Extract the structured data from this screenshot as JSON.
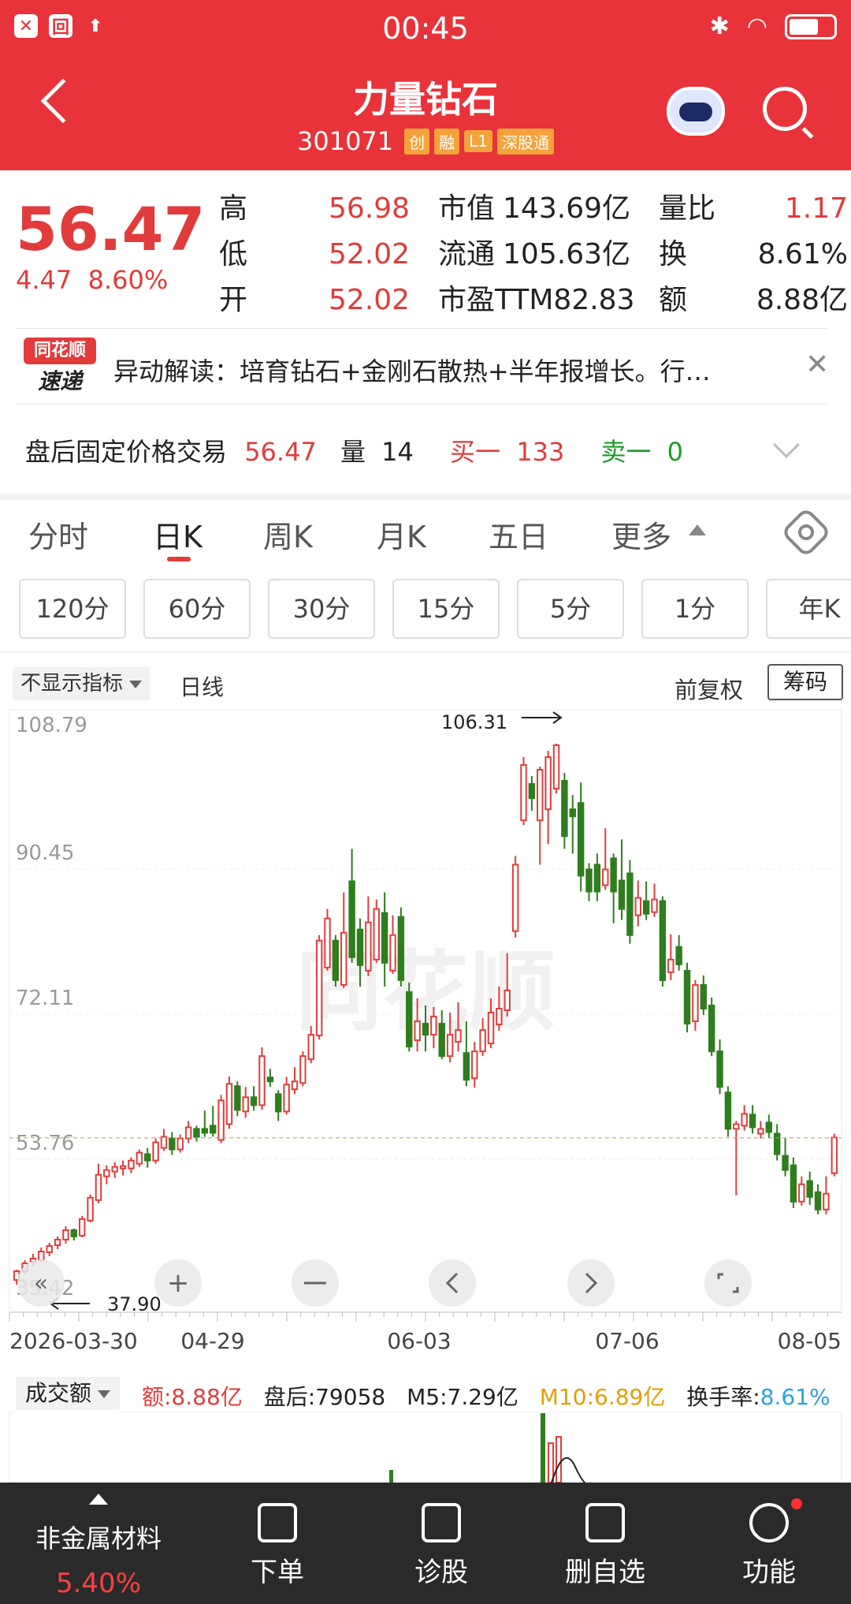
{
  "status_bar": {
    "time": "00:45"
  },
  "header": {
    "title": "力量钻石",
    "code": "301071",
    "tags": [
      "创",
      "融",
      "L1",
      "深股通"
    ]
  },
  "quote": {
    "price": "56.47",
    "change": "4.47",
    "change_pct": "8.60%",
    "col1": [
      {
        "label": "高",
        "value": "56.98"
      },
      {
        "label": "低",
        "value": "52.02"
      },
      {
        "label": "开",
        "value": "52.02"
      }
    ],
    "col2": [
      {
        "label": "市值",
        "value": "143.69亿"
      },
      {
        "label": "流通",
        "value": "105.63亿"
      },
      {
        "label": "市盈TTM",
        "value": "82.83"
      }
    ],
    "col3": [
      {
        "label": "量比",
        "value": "1.17"
      },
      {
        "label": "换",
        "value": "8.61%"
      },
      {
        "label": "额",
        "value": "8.88亿"
      }
    ]
  },
  "news": {
    "logo_top": "同花顺",
    "logo_bottom": "速递",
    "text": "异动解读：培育钻石+金刚石散热+半年报增长。行…"
  },
  "after_hours": {
    "label": "盘后固定价格交易",
    "price": "56.47",
    "vol_label": "量",
    "vol": "14",
    "buy_label": "买一",
    "buy": "133",
    "sell_label": "卖一",
    "sell": "0"
  },
  "tabs": [
    "分时",
    "日K",
    "周K",
    "月K",
    "五日",
    "更多"
  ],
  "periods": [
    "120分",
    "60分",
    "30分",
    "15分",
    "5分",
    "1分",
    "年K"
  ],
  "chart_toolbar": {
    "indicator": "不显示指标",
    "line_type": "日线",
    "adjust": "前复权",
    "chips": "筹码"
  },
  "chart_data": {
    "type": "candlestick",
    "y_ticks": [
      "108.79",
      "90.45",
      "72.11",
      "53.76",
      "35.42"
    ],
    "ylim": [
      35.42,
      108.79
    ],
    "x_ticks": [
      "2026-03-30",
      "04-29",
      "06-03",
      "07-06",
      "08-05"
    ],
    "max_label": "106.31",
    "min_label": "37.90",
    "last_close": 56.47,
    "up_color": "#e23b3b",
    "down_color": "#2f7d1f",
    "candles": [
      [
        38.5,
        39.6,
        37.9,
        39.8
      ],
      [
        39.6,
        40.6,
        39.3,
        41.0
      ],
      [
        40.8,
        41.2,
        40.2,
        41.8
      ],
      [
        41.0,
        42.1,
        40.8,
        42.6
      ],
      [
        42.0,
        42.8,
        41.5,
        43.2
      ],
      [
        42.9,
        43.6,
        42.4,
        44.0
      ],
      [
        43.6,
        44.8,
        43.1,
        45.3
      ],
      [
        44.8,
        44.0,
        43.5,
        45.0
      ],
      [
        44.1,
        46.2,
        43.9,
        46.6
      ],
      [
        46.0,
        48.9,
        45.8,
        49.3
      ],
      [
        48.6,
        51.8,
        48.2,
        53.2
      ],
      [
        51.6,
        52.4,
        50.6,
        53.0
      ],
      [
        52.2,
        52.8,
        51.4,
        53.4
      ],
      [
        52.6,
        52.9,
        51.7,
        53.6
      ],
      [
        52.6,
        53.6,
        52.0,
        54.0
      ],
      [
        53.2,
        54.6,
        52.8,
        55.0
      ],
      [
        54.4,
        53.6,
        52.7,
        55.2
      ],
      [
        53.6,
        55.9,
        53.2,
        56.4
      ],
      [
        55.2,
        56.6,
        54.8,
        57.6
      ],
      [
        56.4,
        55.0,
        54.3,
        57.2
      ],
      [
        55.0,
        56.4,
        54.6,
        56.9
      ],
      [
        56.4,
        57.8,
        55.8,
        58.6
      ],
      [
        57.6,
        56.6,
        56.0,
        58.0
      ],
      [
        57.6,
        57.1,
        56.6,
        59.9
      ],
      [
        58.0,
        57.1,
        56.6,
        60.5
      ],
      [
        56.2,
        61.2,
        55.8,
        61.9
      ],
      [
        58.2,
        63.3,
        57.6,
        64.2
      ],
      [
        63.0,
        60.0,
        59.2,
        63.6
      ],
      [
        59.8,
        61.6,
        59.0,
        62.9
      ],
      [
        61.6,
        60.6,
        59.9,
        63.0
      ],
      [
        60.6,
        66.8,
        60.0,
        67.9
      ],
      [
        64.1,
        63.6,
        62.9,
        65.2
      ],
      [
        62.0,
        59.8,
        58.6,
        62.5
      ],
      [
        59.8,
        63.2,
        59.4,
        64.2
      ],
      [
        62.6,
        63.6,
        62.0,
        65.4
      ],
      [
        63.4,
        66.8,
        63.0,
        67.4
      ],
      [
        66.4,
        69.5,
        65.9,
        70.6
      ],
      [
        69.4,
        81.4,
        68.9,
        82.1
      ],
      [
        78.0,
        84.2,
        77.6,
        85.4
      ],
      [
        81.4,
        76.4,
        75.6,
        82.1
      ],
      [
        75.8,
        82.4,
        75.4,
        87.5
      ],
      [
        88.9,
        79.3,
        78.6,
        93.0
      ],
      [
        82.8,
        78.3,
        75.6,
        84.2
      ],
      [
        77.6,
        83.7,
        76.9,
        87.0
      ],
      [
        79.0,
        85.4,
        78.6,
        86.6
      ],
      [
        84.9,
        78.6,
        75.6,
        87.5
      ],
      [
        77.6,
        82.1,
        77.2,
        84.6
      ],
      [
        84.4,
        76.4,
        75.6,
        85.6
      ],
      [
        74.9,
        68.0,
        67.4,
        76.1
      ],
      [
        68.8,
        71.2,
        67.4,
        74.1
      ],
      [
        70.9,
        69.5,
        67.4,
        73.2
      ],
      [
        69.5,
        71.8,
        67.8,
        73.0
      ],
      [
        70.9,
        66.8,
        66.4,
        72.6
      ],
      [
        66.8,
        69.5,
        66.0,
        72.3
      ],
      [
        68.6,
        70.1,
        67.4,
        73.6
      ],
      [
        67.2,
        63.8,
        63.0,
        71.2
      ],
      [
        64.0,
        67.4,
        62.8,
        68.6
      ],
      [
        67.4,
        70.1,
        66.8,
        71.6
      ],
      [
        68.4,
        72.3,
        67.8,
        74.1
      ],
      [
        70.8,
        72.8,
        70.0,
        75.6
      ],
      [
        72.6,
        75.1,
        71.8,
        79.8
      ],
      [
        82.6,
        91.0,
        81.8,
        92.1
      ],
      [
        96.6,
        103.6,
        96.0,
        104.6
      ],
      [
        101.2,
        99.4,
        97.8,
        102.2
      ],
      [
        96.6,
        103.0,
        91.0,
        103.4
      ],
      [
        98.0,
        104.6,
        93.6,
        105.4
      ],
      [
        100.6,
        106.1,
        100.0,
        106.3
      ],
      [
        101.6,
        94.6,
        93.0,
        102.6
      ],
      [
        98.0,
        97.1,
        92.4,
        99.8
      ],
      [
        98.8,
        89.6,
        87.6,
        101.4
      ],
      [
        90.4,
        87.6,
        86.4,
        91.2
      ],
      [
        91.0,
        87.6,
        86.4,
        92.4
      ],
      [
        88.4,
        90.4,
        87.8,
        95.6
      ],
      [
        91.8,
        87.6,
        83.6,
        92.4
      ],
      [
        89.0,
        85.4,
        84.0,
        94.2
      ],
      [
        89.9,
        82.1,
        81.0,
        91.6
      ],
      [
        84.6,
        86.8,
        83.2,
        89.0
      ],
      [
        86.4,
        84.8,
        84.0,
        88.9
      ],
      [
        85.0,
        86.6,
        84.4,
        88.6
      ],
      [
        86.4,
        76.4,
        75.6,
        87.0
      ],
      [
        77.4,
        79.0,
        76.4,
        82.2
      ],
      [
        80.6,
        78.4,
        77.6,
        82.1
      ],
      [
        77.6,
        70.9,
        69.8,
        78.6
      ],
      [
        71.2,
        75.8,
        70.0,
        76.4
      ],
      [
        75.8,
        72.8,
        72.0,
        77.0
      ],
      [
        73.2,
        67.4,
        66.8,
        74.2
      ],
      [
        67.4,
        62.9,
        62.0,
        68.9
      ],
      [
        62.2,
        57.6,
        56.6,
        63.0
      ],
      [
        57.6,
        58.2,
        49.2,
        58.6
      ],
      [
        58.0,
        59.5,
        57.4,
        60.6
      ],
      [
        59.4,
        57.8,
        57.0,
        60.6
      ],
      [
        57.0,
        57.6,
        56.4,
        58.6
      ],
      [
        58.4,
        57.2,
        56.4,
        59.4
      ],
      [
        57.0,
        54.4,
        53.6,
        58.2
      ],
      [
        54.2,
        52.4,
        51.6,
        56.4
      ],
      [
        53.0,
        48.4,
        47.6,
        54.0
      ],
      [
        48.4,
        50.6,
        47.9,
        51.6
      ],
      [
        51.0,
        49.0,
        48.0,
        52.2
      ],
      [
        49.6,
        47.4,
        46.8,
        50.6
      ],
      [
        47.4,
        49.4,
        46.8,
        51.6
      ],
      [
        52.0,
        56.5,
        51.6,
        57.0
      ]
    ]
  },
  "volume": {
    "selector": "成交额",
    "amount": "额:8.88亿",
    "after": "盘后:79058",
    "m5": "M5:7.29亿",
    "m10": "M10:6.89亿",
    "turnover_label": "换手率:",
    "turnover": "8.61%"
  },
  "bottom_bar": {
    "sector_name": "非金属材料",
    "sector_pct": "5.40%",
    "items": [
      "下单",
      "诊股",
      "删自选",
      "功能"
    ]
  }
}
